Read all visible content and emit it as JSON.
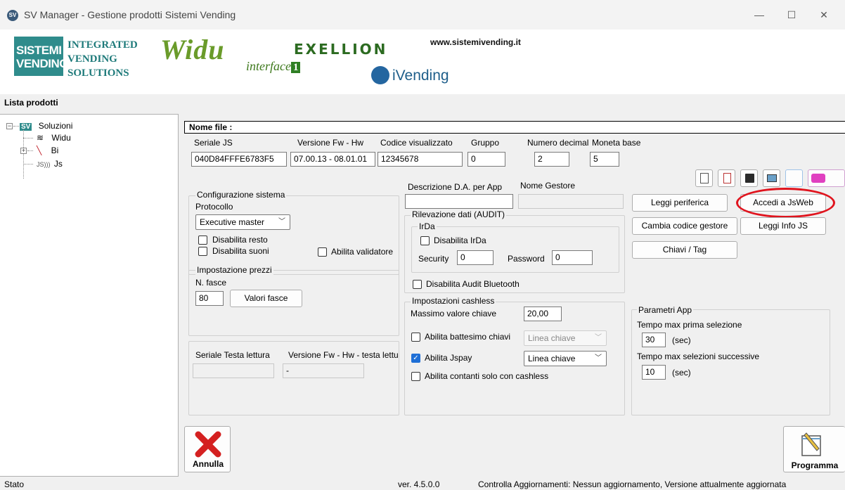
{
  "window": {
    "title": "SV Manager - Gestione prodotti Sistemi Vending",
    "icon_label": "SV",
    "minimize_glyph": "—",
    "maximize_glyph": "☐",
    "close_glyph": "✕"
  },
  "banner": {
    "sv_logo_text": "SISTEMI VENDING",
    "ivs_line1": "INTEGRATED",
    "ivs_line2": "VENDING",
    "ivs_line3": "SOLUTIONS",
    "widu": "Widu",
    "interface_text": "interface",
    "interface_num": "1",
    "exellion": "EXELLION",
    "ivending": "iVending",
    "website": "www.sistemivending.it"
  },
  "products": {
    "title": "Lista prodotti",
    "root": {
      "badge": "SV",
      "label": "Soluzioni"
    },
    "items": [
      {
        "label": "Widu",
        "icon": "wifi-icon"
      },
      {
        "label": "Bi",
        "icon": "chili-icon"
      },
      {
        "label": "Js",
        "icon": "js-wireless-icon"
      }
    ]
  },
  "main": {
    "nome_file_label": "Nome file :",
    "seriale_label": "Seriale JS",
    "seriale_value": "040D84FFFE6783F5",
    "versione_label": "Versione Fw - Hw",
    "versione_value": "07.00.13 - 08.01.01",
    "codice_label": "Codice visualizzato",
    "codice_value": "12345678",
    "gruppo_label": "Gruppo",
    "gruppo_value": "0",
    "decimali_label": "Numero decimal",
    "decimali_value": "2",
    "moneta_label": "Moneta base",
    "moneta_value": "5",
    "descrizione_label": "Descrizione D.A. per App",
    "descrizione_value": "",
    "gestore_label": "Nome Gestore",
    "gestore_value": ""
  },
  "config": {
    "title": "Configurazione sistema",
    "protocollo_label": "Protocollo",
    "protocollo_value": "Executive master",
    "disabilita_resto": "Disabilita resto",
    "disabilita_suoni": "Disabilita suoni",
    "abilita_validatore": "Abilita validatore",
    "prezzi_title": "Impostazione prezzi",
    "fasce_label": "N. fasce",
    "fasce_value": "80",
    "valori_fasce": "Valori fasce"
  },
  "testa": {
    "seriale_label": "Seriale Testa lettura",
    "seriale_value": "",
    "versione_label": "Versione Fw - Hw - testa lettu",
    "versione_value": "-"
  },
  "audit": {
    "title": "Rilevazione dati (AUDIT)",
    "irda_title": "IrDa",
    "disabilita_irda": "Disabilita IrDa",
    "security_label": "Security",
    "security_value": "0",
    "password_label": "Password",
    "password_value": "0",
    "disabilita_bluetooth": "Disabilita Audit Bluetooth"
  },
  "cashless": {
    "title": "Impostazioni cashless",
    "max_label": "Massimo valore chiave",
    "max_value": "20,00",
    "battesimo": "Abilita battesimo chiavi",
    "battesimo_select": "Linea chiave",
    "jspay": "Abilita Jspay",
    "jspay_select": "Linea chiave",
    "contanti": "Abilita contanti solo con cashless",
    "check_glyph": "✓"
  },
  "actions": {
    "leggi_periferica": "Leggi periferica",
    "accedi_jsweb": "Accedi a JsWeb",
    "cambia_codice": "Cambia codice gestore",
    "leggi_info": "Leggi Info JS",
    "chiavi_tag": "Chiavi / Tag",
    "highlight_color": "#e0141e"
  },
  "app_params": {
    "title": "Parametri App",
    "prima_label": "Tempo max prima selezione",
    "prima_value": "30",
    "prima_unit": "(sec)",
    "succ_label": "Tempo max selezioni successive",
    "succ_value": "10",
    "succ_unit": "(sec)"
  },
  "footer": {
    "annulla": "Annulla",
    "programma": "Programma",
    "stato": "Stato",
    "version": "ver. 4.5.0.0",
    "update_msg": "Controlla Aggiornamenti: Nessun aggiornamento, Versione attualmente aggiornata"
  }
}
